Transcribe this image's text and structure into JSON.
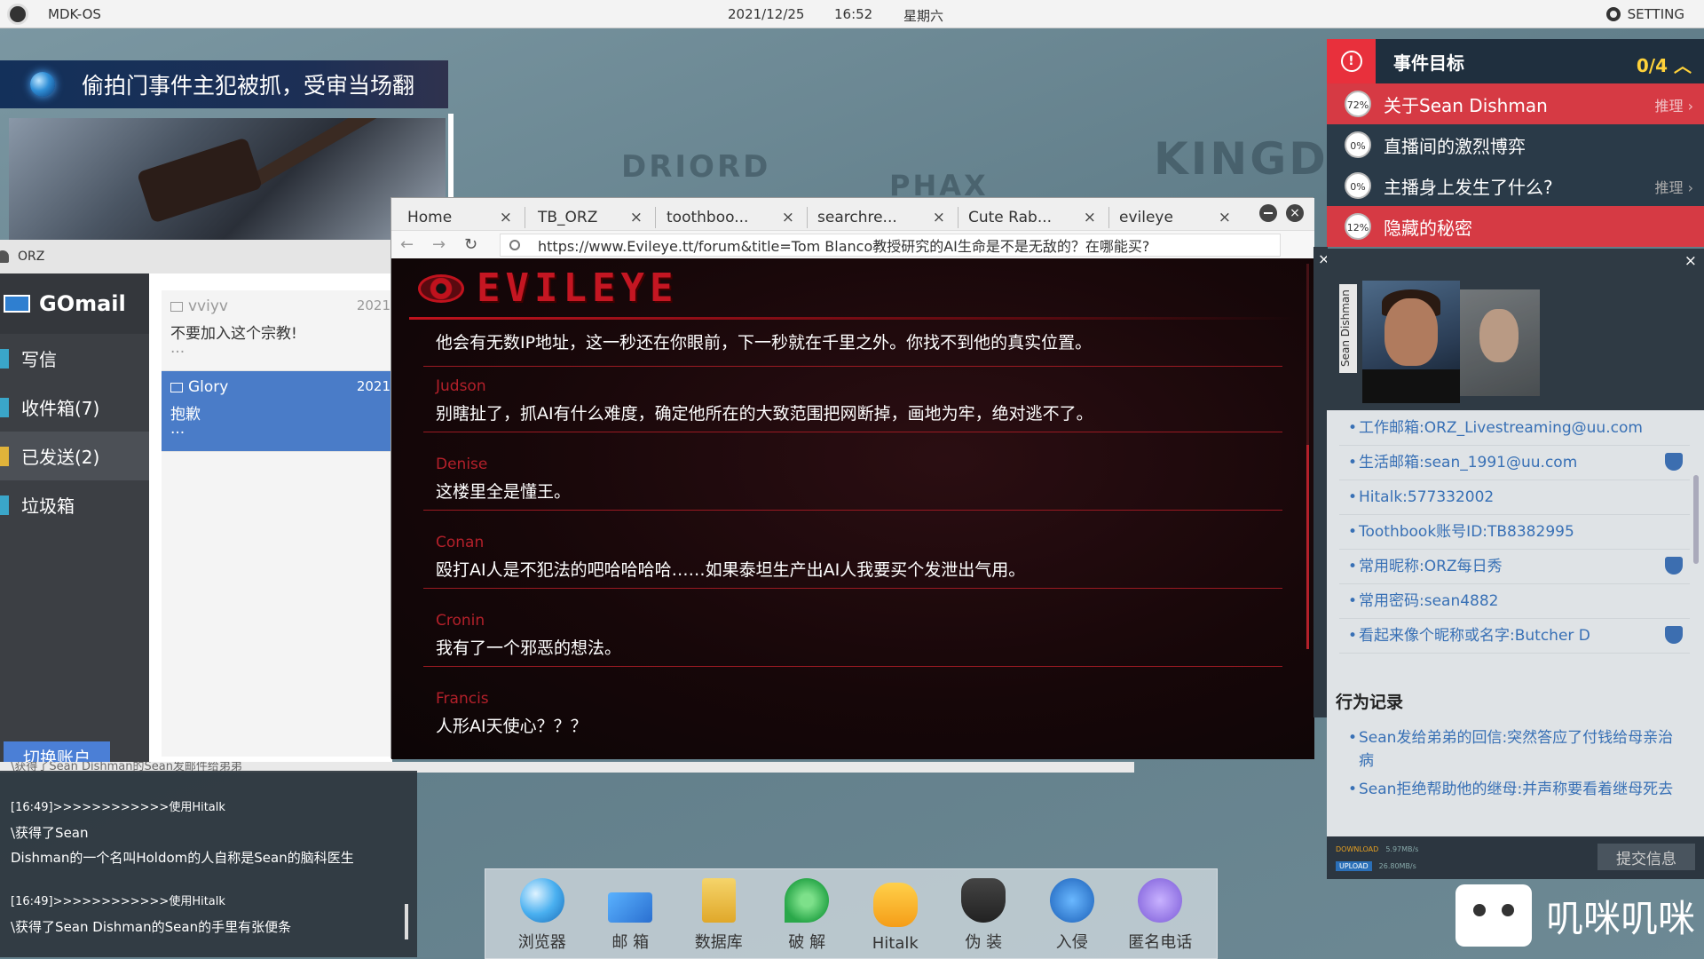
{
  "topbar": {
    "os_name": "MDK-OS",
    "date": "2021/12/25",
    "time": "16:52",
    "weekday": "星期六",
    "setting": "SETTING"
  },
  "news": {
    "headline": "偷拍门事件主犯被抓，受审当场翻"
  },
  "map_labels": [
    "DRIORD",
    "PHAX",
    "KINGDO"
  ],
  "mail": {
    "title_account": "ORZ",
    "brand": "GOmail",
    "nav": [
      {
        "label": "写信"
      },
      {
        "label": "收件箱(7)"
      },
      {
        "label": "已发送(2)"
      },
      {
        "label": "垃圾箱"
      }
    ],
    "switch_account": "切换账户",
    "items": [
      {
        "from": "vviyv",
        "year": "2021",
        "subject": "不要加入这个宗教!",
        "dots": "..."
      },
      {
        "from": "Glory",
        "year": "2021",
        "subject": "抱歉",
        "dots": "..."
      }
    ]
  },
  "log": {
    "cut_line": "\\获得了Sean Dishman的Sean发邮件给弟弟",
    "entries": [
      {
        "time": "[16:49]>>>>>>>>>>>>使用Hitalk",
        "lines": [
          "\\获得了Sean",
          "Dishman的一个名叫Holdom的人自称是Sean的脑科医生"
        ]
      },
      {
        "time": "[16:49]>>>>>>>>>>>>使用Hitalk",
        "lines": [
          "\\获得了Sean Dishman的Sean的手里有张便条"
        ]
      }
    ]
  },
  "browser": {
    "tabs": [
      "Home",
      "TB_ORZ",
      "toothboo...",
      "searchre...",
      "Cute Rab...",
      "evileye"
    ],
    "url": "https://www.Evileye.tt/forum&title=Tom Blanco教授研究的AI生命是不是无敌的？在哪能买?",
    "site_name": "EVILEYE",
    "posts": [
      {
        "author": "",
        "text": "他会有无数IP地址，这一秒还在你眼前，下一秒就在千里之外。你找不到他的真实位置。"
      },
      {
        "author": "Judson",
        "text": "别瞎扯了，抓AI有什么难度，确定他所在的大致范围把网断掉，画地为牢，绝对逃不了。"
      },
      {
        "author": "Denise",
        "text": "这楼里全是懂王。"
      },
      {
        "author": "Conan",
        "text": "殴打AI人是不犯法的吧哈哈哈哈……如果泰坦生产出AI人我要买个发泄出气用。"
      },
      {
        "author": "Cronin",
        "text": "我有了一个邪恶的想法。"
      },
      {
        "author": "Francis",
        "text": "人形AI天使心？？？"
      }
    ]
  },
  "objectives": {
    "title": "事件目标",
    "count": "0/4",
    "items": [
      {
        "pct": "72%",
        "label": "关于Sean Dishman",
        "infer": "推理",
        "style": "red"
      },
      {
        "pct": "0%",
        "label": "直播间的激烈博弈",
        "infer": "",
        "style": "dark"
      },
      {
        "pct": "0%",
        "label": "主播身上发生了什么?",
        "infer": "推理",
        "style": "dark"
      },
      {
        "pct": "12%",
        "label": "隐藏的秘密",
        "infer": "",
        "style": "red"
      }
    ]
  },
  "profile": {
    "name_vertical": "Sean Dishman",
    "info": [
      {
        "text": "工作邮箱:ORZ_Livestreaming@uu.com",
        "shield": false
      },
      {
        "text": "生活邮箱:sean_1991@uu.com",
        "shield": true
      },
      {
        "text": "Hitalk:577332002",
        "shield": false
      },
      {
        "text": "Toothbook账号ID:TB8382995",
        "shield": false
      },
      {
        "text": "常用昵称:ORZ每日秀",
        "shield": true
      },
      {
        "text": "常用密码:sean4882",
        "shield": false
      },
      {
        "text": "看起来像个昵称或名字:Butcher D",
        "shield": true
      }
    ],
    "behavior_title": "行为记录",
    "behavior": [
      "Sean发给弟弟的回信:突然答应了付钱给母亲治病",
      "Sean拒绝帮助他的继母:并声称要看着继母死去"
    ],
    "net": {
      "download_label": "DOWNLOAD",
      "download_speed": "5.97MB/s",
      "upload_label": "UPLOAD",
      "upload_speed": "26.80MB/s"
    },
    "submit": "提交信息"
  },
  "dock": [
    {
      "label": "浏览器",
      "icon": "browser-icon"
    },
    {
      "label": "邮 箱",
      "icon": "mail-icon"
    },
    {
      "label": "数据库",
      "icon": "database-icon"
    },
    {
      "label": "破 解",
      "icon": "crack-icon"
    },
    {
      "label": "Hitalk",
      "icon": "hitalk-icon"
    },
    {
      "label": "伪 装",
      "icon": "disguise-icon"
    },
    {
      "label": "入侵",
      "icon": "invade-icon"
    },
    {
      "label": "匿名电话",
      "icon": "call-icon"
    }
  ],
  "watermark": "叽咪叽咪"
}
